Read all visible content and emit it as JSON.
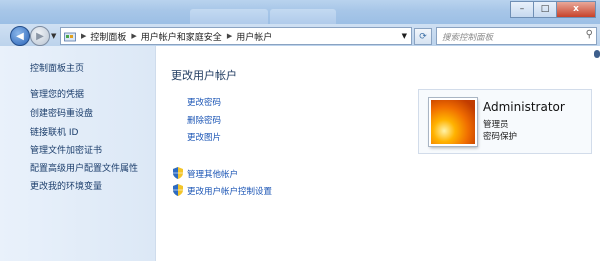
{
  "window": {
    "controls": {
      "minimize": "–",
      "maximize": "□",
      "close": "x"
    }
  },
  "address": {
    "segments": [
      "控制面板",
      "用户帐户和家庭安全",
      "用户帐户"
    ],
    "refresh": "⟳"
  },
  "search": {
    "placeholder": "搜索控制面板"
  },
  "sidebar": {
    "home": "控制面板主页",
    "links": [
      "管理您的凭据",
      "创建密码重设盘",
      "链接联机 ID",
      "管理文件加密证书",
      "配置高级用户配置文件属性",
      "更改我的环境变量"
    ]
  },
  "main": {
    "title": "更改用户帐户",
    "tasks": [
      "更改密码",
      "删除密码",
      "更改图片"
    ],
    "shield_tasks": [
      "管理其他帐户",
      "更改用户帐户控制设置"
    ]
  },
  "user": {
    "name": "Administrator",
    "role": "管理员",
    "status": "密码保护"
  },
  "colors": {
    "link": "#1b55b5",
    "sidebar_link": "#1b3d6b",
    "title": "#1e3a5f"
  }
}
